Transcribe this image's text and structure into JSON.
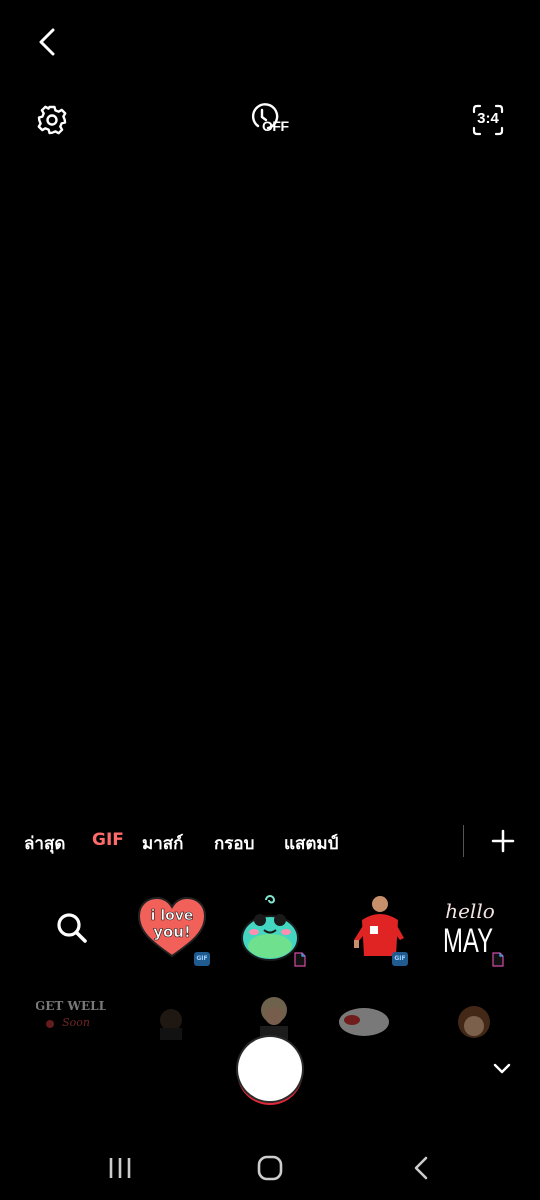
{
  "top_bar": {
    "timer_label": "OFF",
    "ratio_label": "3:4"
  },
  "icons": {
    "back": "chevron-left-icon",
    "settings": "gear-icon",
    "timer": "timer-icon",
    "ratio": "aspect-ratio-icon",
    "add": "plus-icon",
    "search": "search-icon",
    "collapse": "chevron-down-icon"
  },
  "tabs": [
    {
      "label": "ล่าสุด",
      "active": false
    },
    {
      "label": "GIF",
      "active": true
    },
    {
      "label": "มาสก์",
      "active": false
    },
    {
      "label": "กรอบ",
      "active": false
    },
    {
      "label": "แสตมป์",
      "active": false
    }
  ],
  "stickers": [
    {
      "name": "i love you heart",
      "text": "i love you!",
      "badge": "GIF"
    },
    {
      "name": "green frog",
      "badge": "doc"
    },
    {
      "name": "football player red shirt",
      "badge": "GIF"
    },
    {
      "name": "hello may",
      "text_top": "hello",
      "text_bottom": "MAY",
      "badge": "doc"
    }
  ],
  "faded_stickers": [
    {
      "name": "get well soon",
      "text_top": "GET WELL",
      "text_bottom": "Soon"
    },
    {
      "name": "dark figure"
    },
    {
      "name": "blonde person"
    },
    {
      "name": "red oval"
    },
    {
      "name": "brown hair character"
    }
  ],
  "colors": {
    "background": "#000000",
    "active_tab": "#ff6b6b",
    "shutter": "#ffffff",
    "shutter_ring": "#e0283a"
  },
  "nav_bar": {
    "recents": "recents-icon",
    "home": "home-icon",
    "back": "back-icon"
  }
}
